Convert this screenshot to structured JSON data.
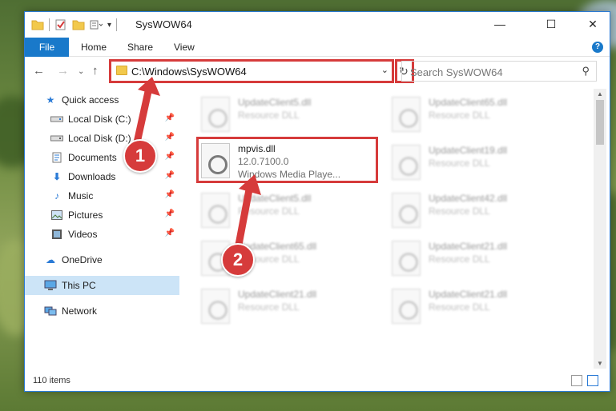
{
  "window": {
    "title": "SysWOW64",
    "minimize": "—",
    "maximize": "☐",
    "close": "✕"
  },
  "ribbon": {
    "tabs": [
      "File",
      "Home",
      "Share",
      "View"
    ],
    "help": "?"
  },
  "address": {
    "path": "C:\\Windows\\SysWOW64",
    "search_placeholder": "Search SysWOW64"
  },
  "sidebar": {
    "items": [
      {
        "label": "Quick access",
        "icon": "star-icon"
      },
      {
        "label": "Local Disk (C:)",
        "icon": "drive-icon",
        "pinned": true
      },
      {
        "label": "Local Disk (D:)",
        "icon": "drive-icon",
        "pinned": true
      },
      {
        "label": "Documents",
        "icon": "documents-icon",
        "pinned": true
      },
      {
        "label": "Downloads",
        "icon": "download-icon",
        "pinned": true
      },
      {
        "label": "Music",
        "icon": "music-icon",
        "pinned": true
      },
      {
        "label": "Pictures",
        "icon": "pictures-icon",
        "pinned": true
      },
      {
        "label": "Videos",
        "icon": "videos-icon",
        "pinned": true
      },
      {
        "label": "OneDrive",
        "icon": "cloud-icon"
      },
      {
        "label": "This PC",
        "icon": "computer-icon",
        "selected": true
      },
      {
        "label": "Network",
        "icon": "network-icon"
      }
    ]
  },
  "files": [
    {
      "name": "UpdateClient5.dll",
      "desc": "Resource DLL"
    },
    {
      "name": "UpdateClient65.dll",
      "desc": "Resource DLL"
    },
    {
      "name": "mpvis.dll",
      "version": "12.0.7100.0",
      "desc": "Windows Media Playe..."
    },
    {
      "name": "UpdateClient19.dll",
      "desc": "Resource DLL"
    },
    {
      "name": "UpdateClient5.dll",
      "desc": "Resource DLL"
    },
    {
      "name": "UpdateClient42.dll",
      "desc": "Resource DLL"
    },
    {
      "name": "UpdateClient65.dll",
      "desc": "Resource DLL"
    },
    {
      "name": "UpdateClient21.dll",
      "desc": "Resource DLL"
    },
    {
      "name": "UpdateClient21.dll",
      "desc": "Resource DLL"
    },
    {
      "name": "UpdateClient21.dll",
      "desc": "Resource DLL"
    }
  ],
  "status": {
    "item_count": "110 items"
  },
  "callouts": {
    "one": "1",
    "two": "2",
    "color": "#d63b3b"
  }
}
